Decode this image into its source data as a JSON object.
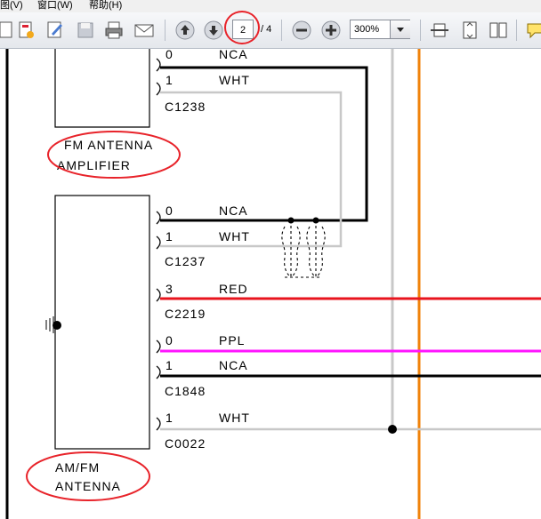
{
  "menu": {
    "view": "图(V)",
    "window": "窗口(W)",
    "help": "帮助(H)"
  },
  "toolbar": {
    "page_current": "2",
    "page_total": "/ 4",
    "zoom": "300%"
  },
  "diagram": {
    "amp_label": [
      "FM ANTENNA",
      "AMPLIFIER"
    ],
    "antenna_label": [
      "AM/FM",
      "ANTENNA"
    ],
    "connectors": {
      "c1238": {
        "name": "C1238",
        "pins": [
          {
            "pin": "0",
            "wire": "NCA"
          },
          {
            "pin": "1",
            "wire": "WHT"
          }
        ]
      },
      "c1237": {
        "name": "C1237",
        "pins": [
          {
            "pin": "0",
            "wire": "NCA"
          },
          {
            "pin": "1",
            "wire": "WHT"
          }
        ]
      },
      "c2219": {
        "name": "C2219",
        "pins": [
          {
            "pin": "3",
            "wire": "RED"
          }
        ]
      },
      "c1848": {
        "name": "C1848",
        "pins": [
          {
            "pin": "0",
            "wire": "PPL"
          },
          {
            "pin": "1",
            "wire": "NCA"
          }
        ]
      },
      "c0022": {
        "name": "C0022",
        "pins": [
          {
            "pin": "1",
            "wire": "WHT"
          }
        ]
      }
    }
  },
  "colors": {
    "wire_red": "#e8141d",
    "wire_ppl": "#ff14ff",
    "wire_nca": "#000000",
    "wire_wht": "#c8c8c8",
    "orange": "#f0820a",
    "annotation": "#e8232a"
  }
}
